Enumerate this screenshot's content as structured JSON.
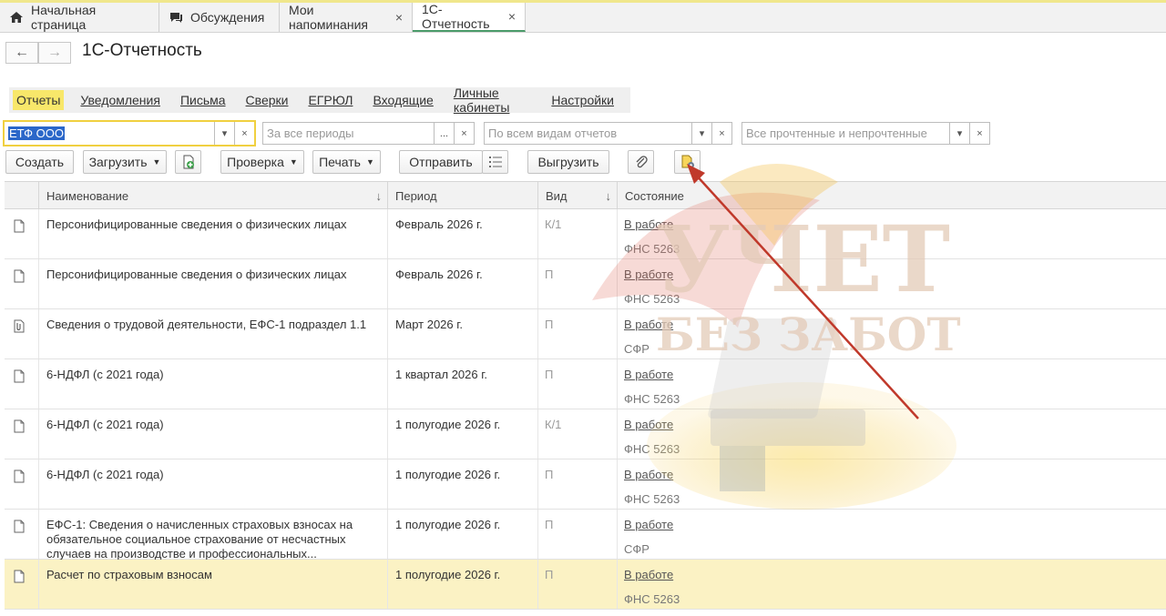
{
  "tabs": [
    {
      "label": "Начальная страница",
      "icon": "home-icon",
      "closable": false
    },
    {
      "label": "Обсуждения",
      "icon": "chat-icon",
      "closable": false
    },
    {
      "label": "Мои напоминания",
      "closable": true
    },
    {
      "label": "1С-Отчетность",
      "closable": true,
      "active": true
    }
  ],
  "tab_close_glyph": "×",
  "nav": {
    "back": "←",
    "forward": "→"
  },
  "page_title": "1С-Отчетность",
  "menu": [
    {
      "label": "Отчеты",
      "active": true
    },
    {
      "label": "Уведомления"
    },
    {
      "label": "Письма"
    },
    {
      "label": "Сверки"
    },
    {
      "label": "ЕГРЮЛ"
    },
    {
      "label": "Входящие"
    },
    {
      "label": "Личные кабинеты"
    },
    {
      "label": "Настройки"
    }
  ],
  "filters": {
    "org": {
      "value": "ЕТФ ООО"
    },
    "period": {
      "placeholder": "За все периоды"
    },
    "kind": {
      "placeholder": "По всем видам отчетов"
    },
    "read": {
      "placeholder": "Все прочтенные и непрочтенные"
    }
  },
  "toolbar": {
    "create": "Создать",
    "load": "Загрузить",
    "check": "Проверка",
    "print": "Печать",
    "send": "Отправить",
    "export": "Выгрузить"
  },
  "columns": {
    "name": "Наименование",
    "period": "Период",
    "kind": "Вид",
    "status": "Состояние",
    "sort_glyph": "↓"
  },
  "rows": [
    {
      "name": "Персонифицированные сведения о физических лицах",
      "period": "Февраль 2026 г.",
      "kind": "К/1",
      "status": "В работе",
      "org": "ФНС 5263"
    },
    {
      "name": "Персонифицированные сведения о физических лицах",
      "period": "Февраль 2026 г.",
      "kind": "П",
      "status": "В работе",
      "org": "ФНС 5263"
    },
    {
      "name": "Сведения о трудовой деятельности, ЕФС-1 подраздел 1.1",
      "period": "Март 2026 г.",
      "kind": "П",
      "status": "В работе",
      "org": "СФР",
      "attached": true
    },
    {
      "name": "6-НДФЛ (с 2021 года)",
      "period": "1 квартал 2026 г.",
      "kind": "П",
      "status": "В работе",
      "org": "ФНС 5263"
    },
    {
      "name": "6-НДФЛ (с 2021 года)",
      "period": "1 полугодие 2026 г.",
      "kind": "К/1",
      "status": "В работе",
      "org": "ФНС 5263"
    },
    {
      "name": "6-НДФЛ (с 2021 года)",
      "period": "1 полугодие 2026 г.",
      "kind": "П",
      "status": "В работе",
      "org": "ФНС 5263"
    },
    {
      "name": "ЕФС-1: Сведения о начисленных страховых взносах на обязательное социальное страхование от несчастных случаев на производстве и профессиональных...",
      "period": "1 полугодие 2026 г.",
      "kind": "П",
      "status": "В работе",
      "org": "СФР"
    },
    {
      "name": "Расчет по страховым взносам",
      "period": "1 полугодие 2026 г.",
      "kind": "П",
      "status": "В работе",
      "org": "ФНС 5263",
      "selected": true
    }
  ],
  "watermark": {
    "line1": "УЧЕТ",
    "line2": "БЕЗ ЗАБОТ"
  },
  "colors": {
    "accent": "#f8e76a",
    "selection": "#2b67c9",
    "highlight_row": "#fbf2c4",
    "arrow": "#c0392b"
  }
}
